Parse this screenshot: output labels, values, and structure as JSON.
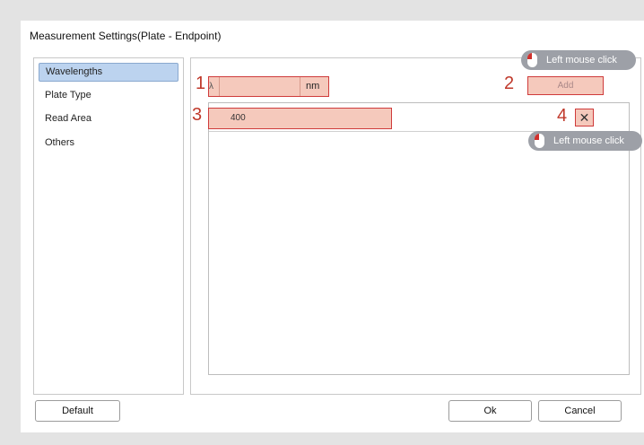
{
  "dialog": {
    "title": "Measurement Settings(Plate - Endpoint)"
  },
  "sidebar": {
    "items": [
      {
        "label": "Wavelengths"
      },
      {
        "label": "Plate Type"
      },
      {
        "label": "Read Area"
      },
      {
        "label": "Others"
      }
    ]
  },
  "wavelengths": {
    "input_prefix": "λ",
    "input_value": "",
    "unit": "nm",
    "add_label": "Add",
    "rows": [
      {
        "value": "400"
      }
    ],
    "delete_glyph": "✕"
  },
  "annotations": {
    "step1": "1",
    "step2": "2",
    "step3": "3",
    "step4": "4",
    "tooltip_add": "Left mouse click",
    "tooltip_delete": "Left mouse click"
  },
  "footer": {
    "default_label": "Default",
    "ok_label": "Ok",
    "cancel_label": "Cancel"
  }
}
